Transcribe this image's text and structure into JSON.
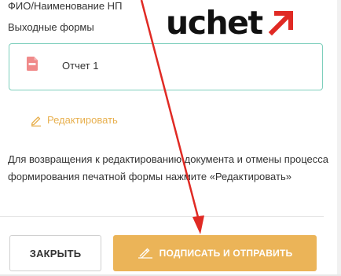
{
  "header": {
    "taxpayer_label": "ФИО/Наименование НП",
    "output_forms_label": "Выходные формы"
  },
  "logo": {
    "text": "uchet",
    "arrow_color": "#e02a24"
  },
  "document": {
    "file_type_icon": "pdf-file-icon",
    "name": "Отчет 1"
  },
  "edit_link": {
    "label": "Редактировать",
    "icon": "pencil-icon"
  },
  "info": {
    "text": "Для возвращения к редактированию документа и отмены процесса формирования печатной формы нажмите «Редактировать»"
  },
  "footer": {
    "close_label": "ЗАКРЫТЬ",
    "sign_label": "ПОДПИСАТЬ И ОТПРАВИТЬ",
    "sign_icon": "signature-icon"
  },
  "colors": {
    "accent": "#ebb458",
    "card_border": "#7dcfbc",
    "annotation_arrow": "#e02a24",
    "pdf_icon": "#f08a8a"
  }
}
